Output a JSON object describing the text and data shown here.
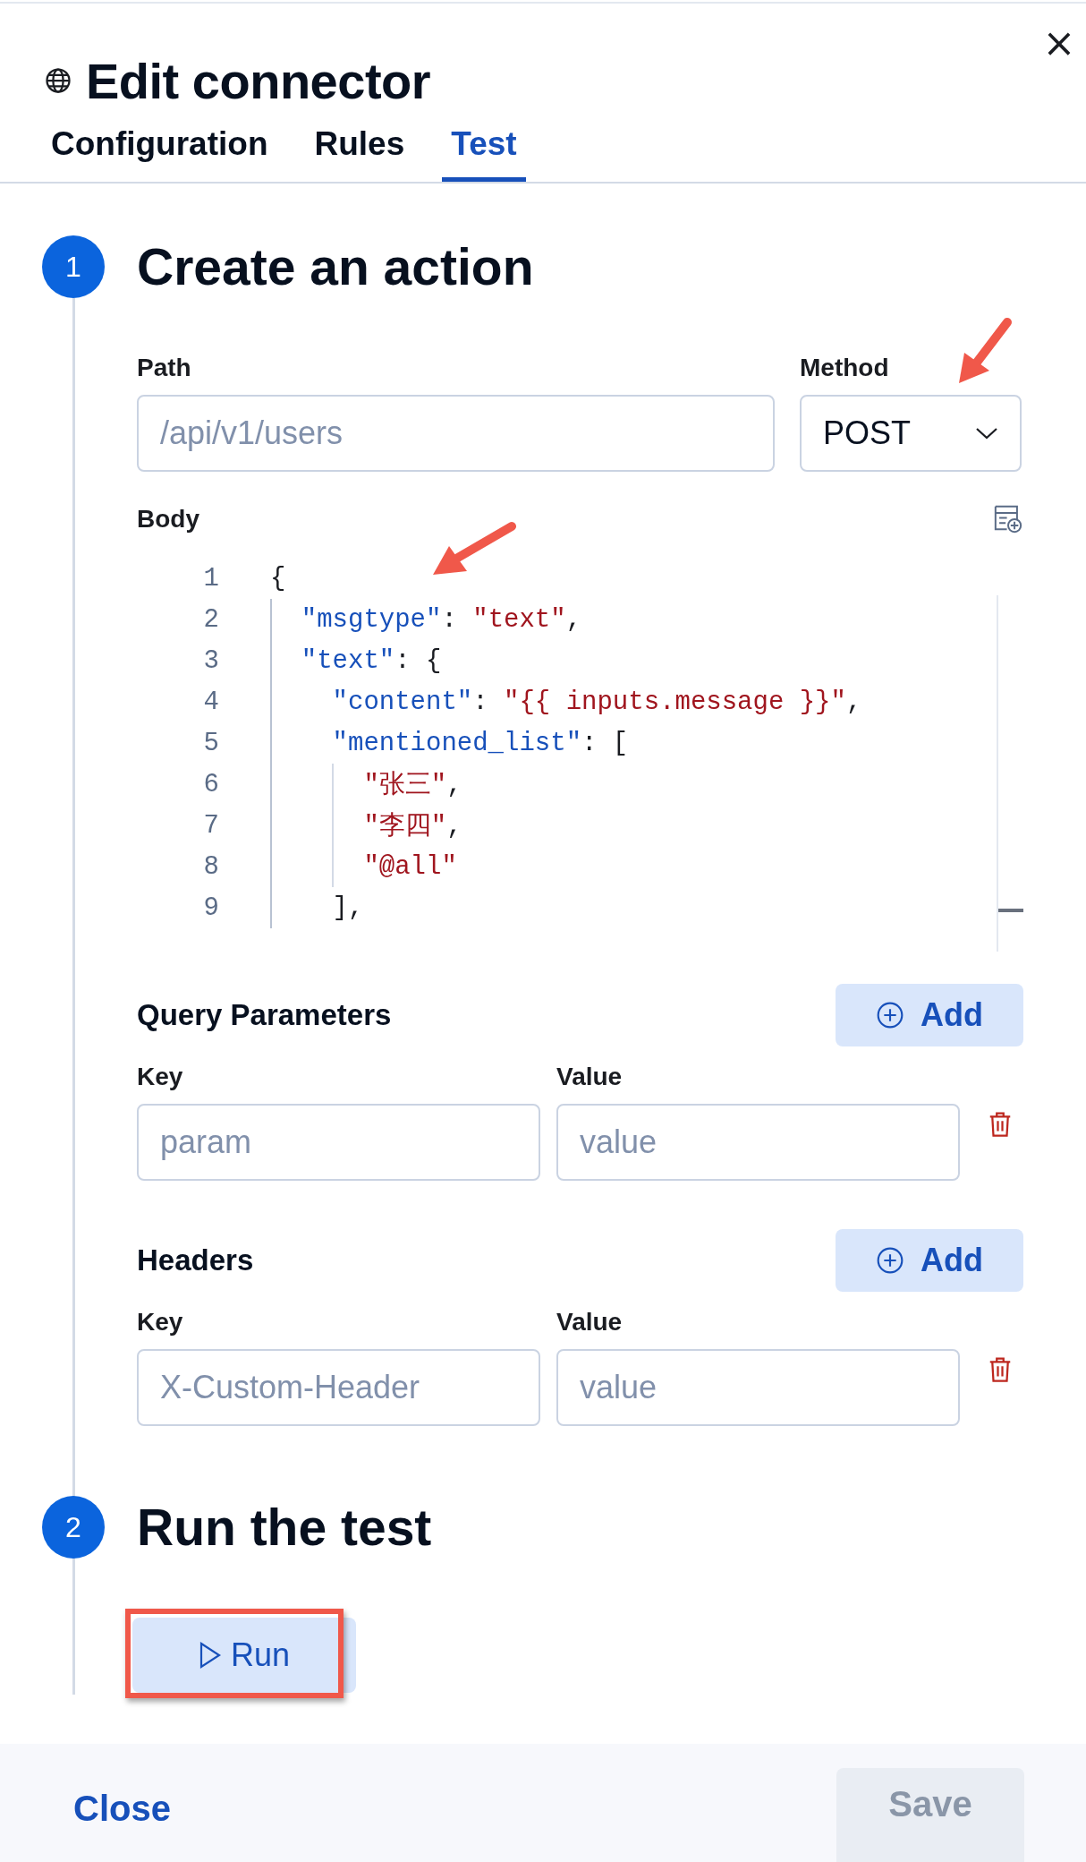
{
  "flyout": {
    "title": "Edit connector",
    "close_label": "×"
  },
  "tabs": [
    {
      "label": "Configuration",
      "selected": false
    },
    {
      "label": "Rules",
      "selected": false
    },
    {
      "label": "Test",
      "selected": true
    }
  ],
  "steps": [
    {
      "number": "1",
      "title": "Create an action"
    },
    {
      "number": "2",
      "title": "Run the test"
    }
  ],
  "path": {
    "label": "Path",
    "placeholder": "/api/v1/users"
  },
  "method": {
    "label": "Method",
    "value": "POST"
  },
  "body": {
    "label": "Body",
    "lines": [
      {
        "number": "1",
        "tokens": [
          {
            "kind": "punct",
            "text": "{"
          }
        ],
        "children": [
          {
            "number": "2",
            "tokens": [
              {
                "kind": "key",
                "text": "\"msgtype\""
              },
              {
                "kind": "punct",
                "text": ": "
              },
              {
                "kind": "string",
                "text": "\"text\""
              },
              {
                "kind": "punct",
                "text": ","
              }
            ]
          },
          {
            "number": "3",
            "tokens": [
              {
                "kind": "key",
                "text": "\"text\""
              },
              {
                "kind": "punct",
                "text": ": {"
              }
            ],
            "children": [
              {
                "number": "4",
                "tokens": [
                  {
                    "kind": "key",
                    "text": "\"content\""
                  },
                  {
                    "kind": "punct",
                    "text": ": "
                  },
                  {
                    "kind": "string",
                    "text": "\"{{ inputs.message }}\""
                  },
                  {
                    "kind": "punct",
                    "text": ","
                  }
                ]
              },
              {
                "number": "5",
                "tokens": [
                  {
                    "kind": "key",
                    "text": "\"mentioned_list\""
                  },
                  {
                    "kind": "punct",
                    "text": ": ["
                  }
                ],
                "children": [
                  {
                    "number": "6",
                    "tokens": [
                      {
                        "kind": "string",
                        "text": "\"张三\""
                      },
                      {
                        "kind": "punct",
                        "text": ","
                      }
                    ]
                  },
                  {
                    "number": "7",
                    "tokens": [
                      {
                        "kind": "string",
                        "text": "\"李四\""
                      },
                      {
                        "kind": "punct",
                        "text": ","
                      }
                    ]
                  },
                  {
                    "number": "8",
                    "tokens": [
                      {
                        "kind": "string",
                        "text": "\"@all\""
                      }
                    ]
                  }
                ]
              },
              {
                "number": "9",
                "tokens": [
                  {
                    "kind": "punct",
                    "text": "],"
                  }
                ]
              }
            ]
          }
        ]
      }
    ]
  },
  "query_parameters": {
    "title": "Query Parameters",
    "add_label": "Add",
    "key_label": "Key",
    "value_label": "Value",
    "key_placeholder": "param",
    "value_placeholder": "value"
  },
  "headers": {
    "title": "Headers",
    "add_label": "Add",
    "key_label": "Key",
    "value_label": "Value",
    "key_placeholder": "X-Custom-Header",
    "value_placeholder": "value"
  },
  "run_button": {
    "label": "Run",
    "highlighted": true
  },
  "footer": {
    "close_label": "Close",
    "save_label": "Save",
    "save_disabled": true
  }
}
